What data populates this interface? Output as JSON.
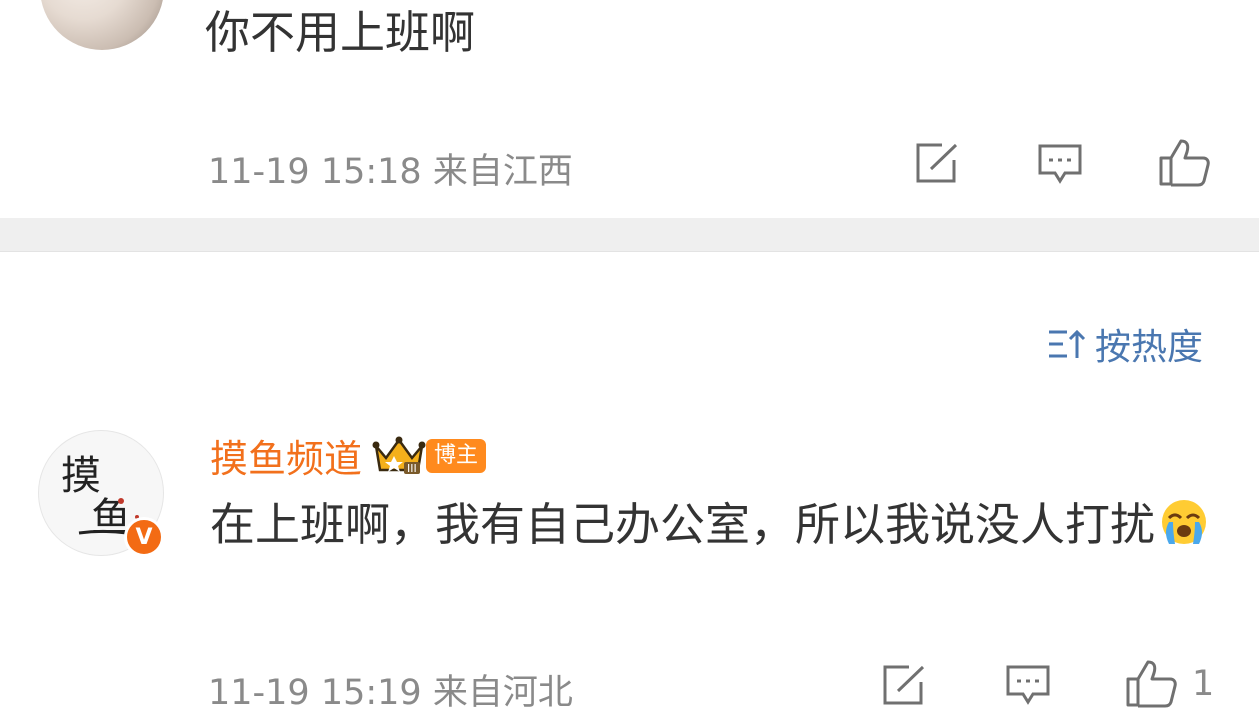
{
  "comments": [
    {
      "text": "你不用上班啊",
      "time": "11-19 15:18",
      "location": "来自江西",
      "like_count": ""
    },
    {
      "username": "摸鱼频道",
      "badge": "博主",
      "verified_mark": "V",
      "text": "在上班啊，我有自己办公室，所以我说没人打扰",
      "time": "11-19 15:19",
      "location": "来自河北",
      "like_count": "1"
    }
  ],
  "sort": {
    "label": "按热度"
  },
  "colors": {
    "username": "#f2701c",
    "sort": "#4a77b0",
    "meta": "#8a8a8a",
    "text": "#333333",
    "divider": "#efefef"
  },
  "icons": [
    "share-icon",
    "comment-icon",
    "like-icon",
    "sort-icon",
    "crown-icon",
    "crying-emoji-icon"
  ]
}
